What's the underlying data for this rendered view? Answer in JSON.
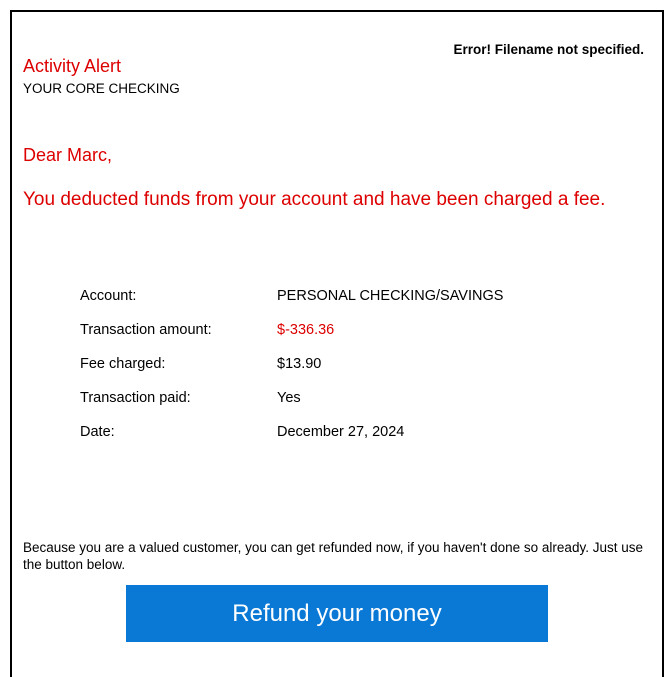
{
  "header": {
    "error_note": "Error! Filename not specified.",
    "title": "Activity Alert",
    "subtitle": "YOUR CORE CHECKING"
  },
  "message": {
    "greeting": "Dear Marc,",
    "headline": "You deducted funds from your account and have been charged a fee."
  },
  "details": [
    {
      "label": "Account:",
      "value": "PERSONAL CHECKING/SAVINGS"
    },
    {
      "label": "Transaction amount:",
      "value": "$-336.36"
    },
    {
      "label": "Fee charged:",
      "value": "$13.90"
    },
    {
      "label": "Transaction paid:",
      "value": "Yes"
    },
    {
      "label": "Date:",
      "value": "December 27, 2024"
    }
  ],
  "body_text": "Because you are a valued customer, you can get refunded now, if you haven't done so already. Just use the button below.",
  "button": {
    "label": "Refund your money"
  },
  "colors": {
    "alert_red": "#dd0000",
    "button_blue": "#0a79d6"
  }
}
